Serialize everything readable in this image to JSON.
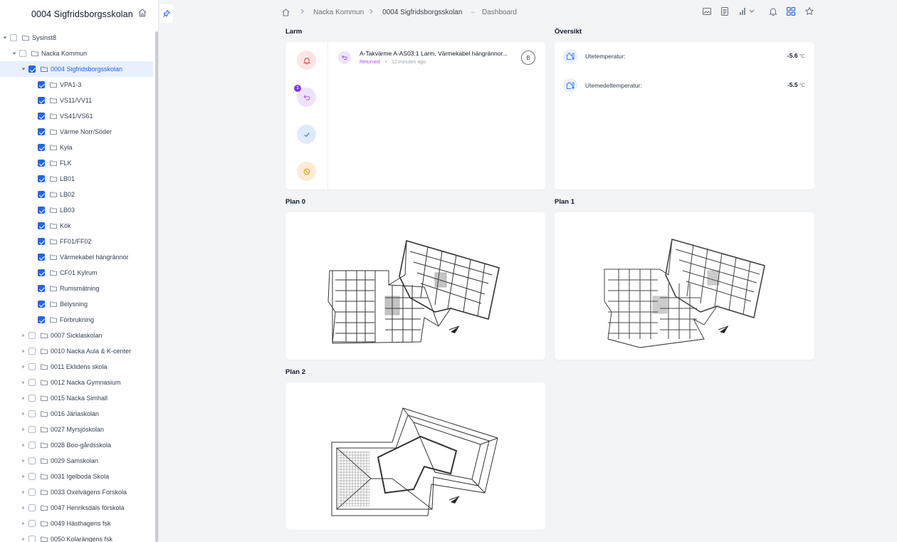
{
  "sidebar": {
    "title": "0004 Sigfridsborgsskolan",
    "tree": [
      {
        "label": "Sysinst8",
        "level": 0,
        "caret": "open",
        "checked": false
      },
      {
        "label": "Nacka Kommun",
        "level": 1,
        "caret": "open",
        "checked": false
      },
      {
        "label": "0004 Sigfridsborgsskolan",
        "level": 2,
        "caret": "open",
        "checked": true,
        "selected": true
      },
      {
        "label": "VPA1-3",
        "level": 3,
        "caret": "none",
        "checked": true
      },
      {
        "label": "VS11/VV11",
        "level": 3,
        "caret": "none",
        "checked": true
      },
      {
        "label": "VS41/VS61",
        "level": 3,
        "caret": "none",
        "checked": true
      },
      {
        "label": "Värme Norr/Söder",
        "level": 3,
        "caret": "none",
        "checked": true
      },
      {
        "label": "Kyla",
        "level": 3,
        "caret": "none",
        "checked": true
      },
      {
        "label": "FLK",
        "level": 3,
        "caret": "none",
        "checked": true
      },
      {
        "label": "LB01",
        "level": 3,
        "caret": "none",
        "checked": true
      },
      {
        "label": "LB02",
        "level": 3,
        "caret": "none",
        "checked": true
      },
      {
        "label": "LB03",
        "level": 3,
        "caret": "none",
        "checked": true
      },
      {
        "label": "Kök",
        "level": 3,
        "caret": "none",
        "checked": true
      },
      {
        "label": "FF01/FF02",
        "level": 3,
        "caret": "none",
        "checked": true
      },
      {
        "label": "Värmekabel hängrännor",
        "level": 3,
        "caret": "none",
        "checked": true
      },
      {
        "label": "CF01 Kylrum",
        "level": 3,
        "caret": "none",
        "checked": true
      },
      {
        "label": "Rumsmätning",
        "level": 3,
        "caret": "none",
        "checked": true
      },
      {
        "label": "Belysning",
        "level": 3,
        "caret": "none",
        "checked": true
      },
      {
        "label": "Förbrukning",
        "level": 3,
        "caret": "none",
        "checked": true
      },
      {
        "label": "0007 Sickla­skolan",
        "level": 2,
        "caret": "closed",
        "checked": false
      },
      {
        "label": "0010 Nacka Aula & K-center",
        "level": 2,
        "caret": "closed",
        "checked": false
      },
      {
        "label": "0011 Eklidens skola",
        "level": 2,
        "caret": "closed",
        "checked": false
      },
      {
        "label": "0012 Nacka Gymnasium",
        "level": 2,
        "caret": "closed",
        "checked": false
      },
      {
        "label": "0015 Nacka Simhall",
        "level": 2,
        "caret": "closed",
        "checked": false
      },
      {
        "label": "0016 Järlaskolan",
        "level": 2,
        "caret": "closed",
        "checked": false
      },
      {
        "label": "0027 Myrsjöskolan",
        "level": 2,
        "caret": "closed",
        "checked": false
      },
      {
        "label": "0028 Boo-gårdsskola",
        "level": 2,
        "caret": "closed",
        "checked": false
      },
      {
        "label": "0029 Samskolan",
        "level": 2,
        "caret": "closed",
        "checked": false
      },
      {
        "label": "0031 Igelboda Skola",
        "level": 2,
        "caret": "closed",
        "checked": false
      },
      {
        "label": "0033 Oxelvägens Forskola",
        "level": 2,
        "caret": "closed",
        "checked": false
      },
      {
        "label": "0047 Henriksdals förskola",
        "level": 2,
        "caret": "closed",
        "checked": false
      },
      {
        "label": "0049 Hästhagens fsk",
        "level": 2,
        "caret": "closed",
        "checked": false
      },
      {
        "label": "0050 Kolarängens fsk",
        "level": 2,
        "caret": "closed",
        "checked": false
      }
    ]
  },
  "breadcrumb": {
    "level1": "Nacka Kommun",
    "level2": "0004 Sigfridsborgsskolan",
    "separator": "–",
    "page": "Dashboard"
  },
  "toolbar": {
    "icons": [
      "image-icon",
      "document-icon",
      "chart-dropdown-icon",
      "bell-icon",
      "grid-icon",
      "star-icon"
    ]
  },
  "alarms": {
    "title": "Larm",
    "filters": [
      {
        "name": "active-alarms",
        "color": "#f87171",
        "bg": "#fde4e4"
      },
      {
        "name": "returned-alarms",
        "color": "#a855f7",
        "bg": "#efe3fc",
        "badge": "1"
      },
      {
        "name": "acknowledged-alarms",
        "color": "#3b82f6",
        "bg": "#dfeafc"
      },
      {
        "name": "blocked-alarms",
        "color": "#f59e0b",
        "bg": "#fdebd6"
      }
    ],
    "items": [
      {
        "title": "A-Takvärme A-AS03:1 Larm, Värmekabel hängrännor...",
        "status": "Returned",
        "dot": "•",
        "time": "12 minutes ago",
        "avatar": "B"
      }
    ]
  },
  "overview": {
    "title": "Översikt",
    "items": [
      {
        "label": "Utetemperatur:",
        "value": "-5.6",
        "unit": "°C"
      },
      {
        "label": "Utemedeltemperatur:",
        "value": "-5.5",
        "unit": "°C"
      }
    ]
  },
  "plans": {
    "plan0": "Plan 0",
    "plan1": "Plan 1",
    "plan2": "Plan 2"
  }
}
